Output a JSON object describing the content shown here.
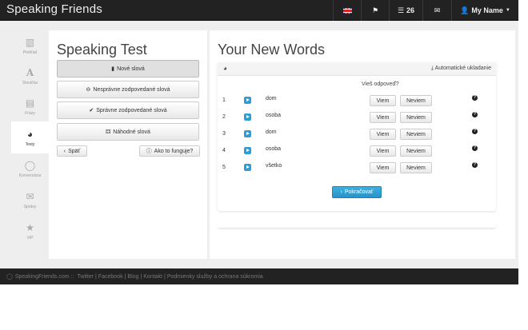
{
  "navbar": {
    "brand": "Speaking Friends",
    "count": "26",
    "user": "My Name"
  },
  "sidebar": {
    "items": [
      {
        "label": "Prehľad",
        "icon": "bar-chart-icon"
      },
      {
        "label": "Slovíčka",
        "icon": "font-icon"
      },
      {
        "label": "Frázy",
        "icon": "newspaper-icon"
      },
      {
        "label": "Testy",
        "icon": "dashboard-icon"
      },
      {
        "label": "Konverzácia",
        "icon": "comment-icon"
      },
      {
        "label": "Správy",
        "icon": "envelope-icon"
      },
      {
        "label": "VIP",
        "icon": "star-icon"
      }
    ]
  },
  "left": {
    "title": "Speaking Test",
    "buttons": {
      "new_words": "Nové slová",
      "wrong": "Nesprávne zodpovedané slová",
      "correct": "Správne zodpovedané slová",
      "random": "Náhodné slová",
      "back": "Späť",
      "how": "Ako to funguje?"
    }
  },
  "right": {
    "title": "Your New Words",
    "autosave": "Automatické ukladanie",
    "question": "Vieš odpoveď?",
    "know_label": "Viem",
    "dont_know_label": "Neviem",
    "continue": "Pokračovať",
    "rows": [
      {
        "num": "1",
        "word": "dom"
      },
      {
        "num": "2",
        "word": "osoba"
      },
      {
        "num": "3",
        "word": "dom"
      },
      {
        "num": "4",
        "word": "osoba"
      },
      {
        "num": "5",
        "word": "všetko"
      }
    ]
  },
  "footer": {
    "site": "SpeakingFriends.com ::",
    "links": [
      "Twitter",
      "Facebook",
      "Blog",
      "Kontakt",
      "Podmienky služby a ochrana súkromia"
    ]
  }
}
